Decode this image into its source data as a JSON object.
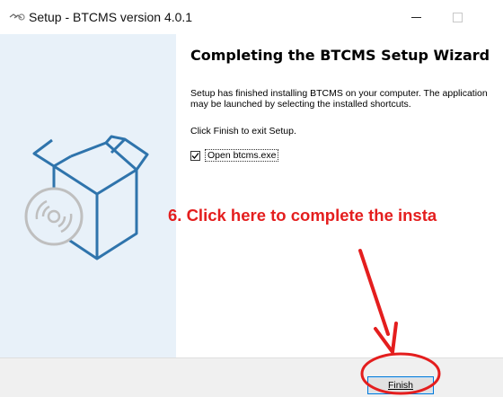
{
  "window": {
    "title": "Setup - BTCMS version 4.0.1",
    "icon": "setup-installer-icon"
  },
  "wizard": {
    "heading": "Completing the BTCMS Setup Wizard",
    "description": "Setup has finished installing BTCMS on your computer. The application may be launched by selecting the installed shortcuts.",
    "click_finish": "Click Finish to exit Setup.",
    "open_checkbox": {
      "label": "Open btcms.exe",
      "checked": true
    }
  },
  "annotation": {
    "text": "6. Click here to complete the insta",
    "color": "#e41e1e"
  },
  "footer": {
    "finish_label": "Finish"
  },
  "colors": {
    "banner_bg": "#e8f1f9",
    "box_stroke": "#2f74ac",
    "accent": "#0078d7"
  }
}
